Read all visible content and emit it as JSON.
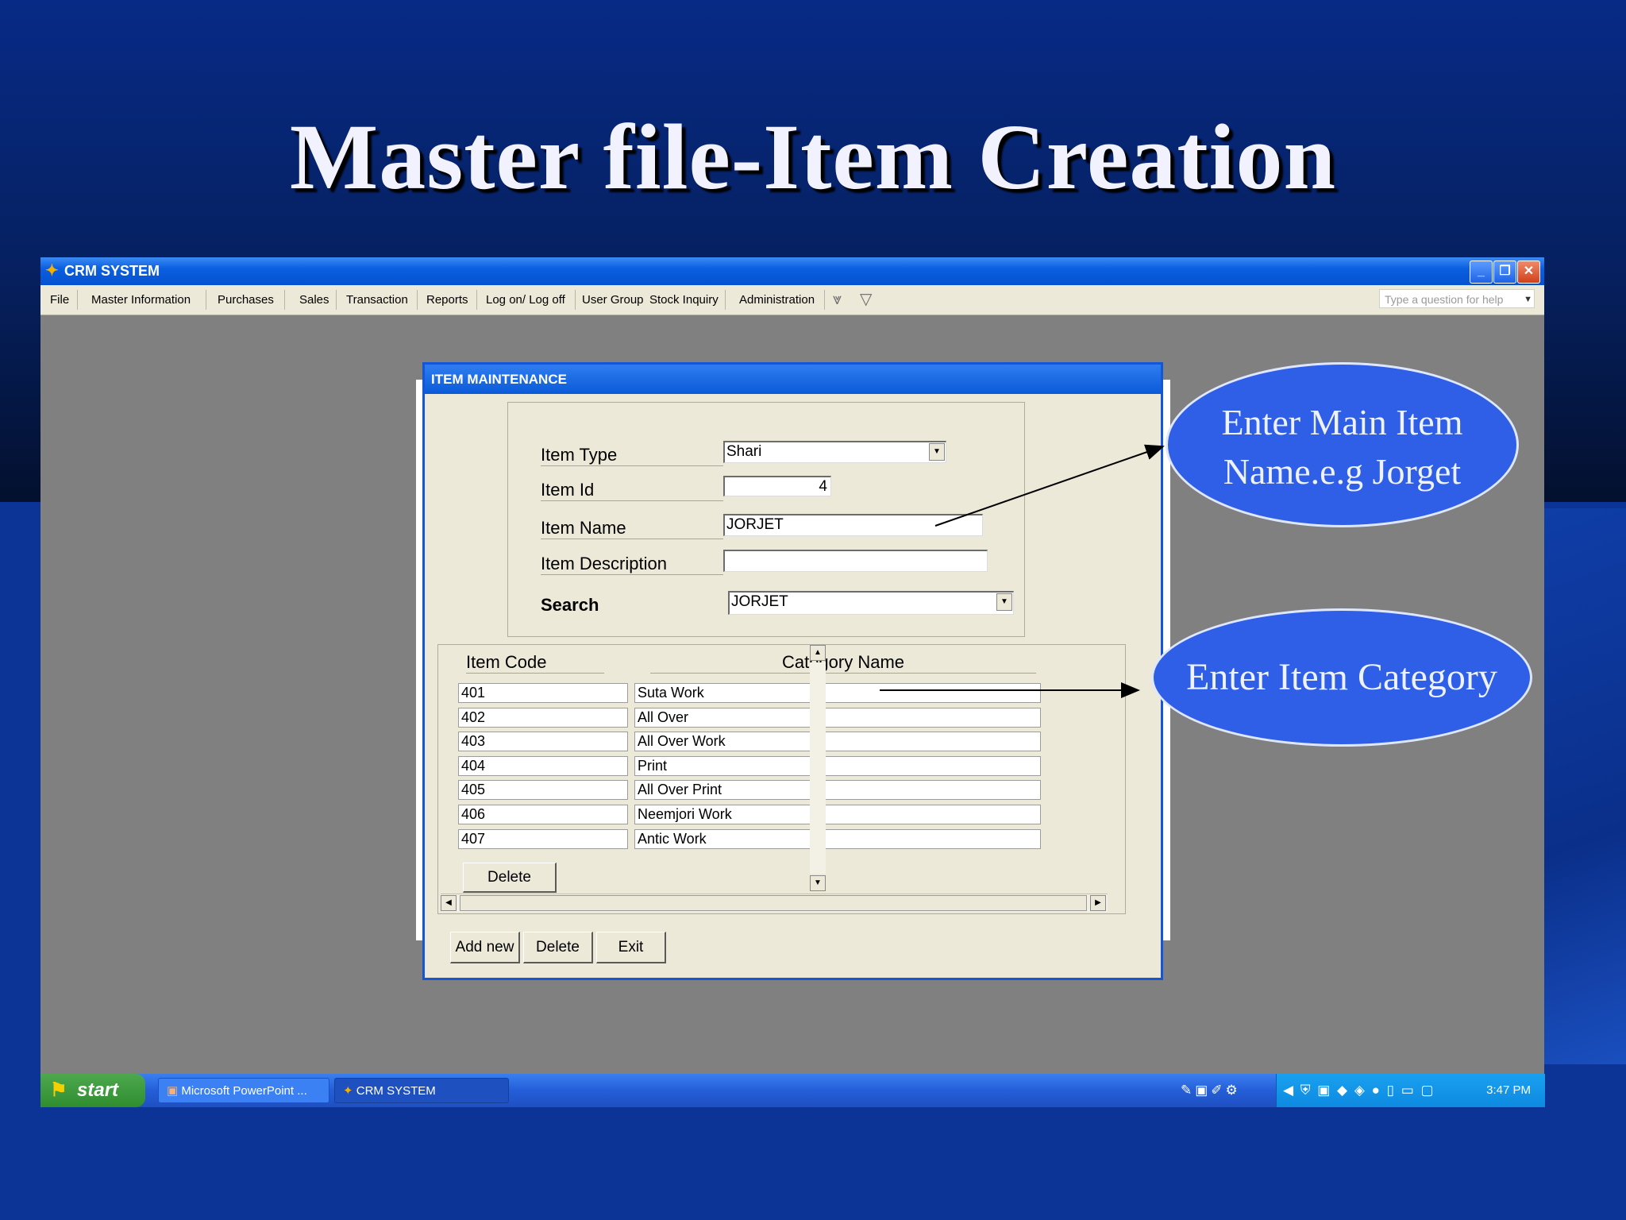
{
  "slide": {
    "title": "Master file-Item Creation"
  },
  "window": {
    "title": "CRM SYSTEM",
    "menu": [
      "File",
      "Master Information",
      "Purchases",
      "Sales",
      "Transaction",
      "Reports",
      "Log on/ Log off",
      "User Group",
      "Stock Inquiry",
      "Administration"
    ],
    "help_placeholder": "Type a question for help"
  },
  "dialog": {
    "title": "ITEM  MAINTENANCE",
    "labels": {
      "item_type": "Item Type",
      "item_id": "Item Id",
      "item_name": "Item Name",
      "item_description": "Item Description",
      "search": "Search"
    },
    "values": {
      "item_type": "Shari",
      "item_id": "4",
      "item_name": "JORJET",
      "item_description": "",
      "search": "JORJET"
    },
    "grid": {
      "headers": {
        "code": "Item Code",
        "name": "Category Name"
      },
      "rows": [
        {
          "code": "401",
          "name": "Suta Work"
        },
        {
          "code": "402",
          "name": "All Over"
        },
        {
          "code": "403",
          "name": "All Over Work"
        },
        {
          "code": "404",
          "name": "Print"
        },
        {
          "code": "405",
          "name": "All Over Print"
        },
        {
          "code": "406",
          "name": "Neemjori Work"
        },
        {
          "code": "407",
          "name": "Antic Work"
        }
      ],
      "delete_label": "Delete"
    },
    "buttons": {
      "add_new": "Add new",
      "delete": "Delete",
      "exit": "Exit"
    }
  },
  "callouts": {
    "main_item": {
      "line1": "Enter Main Item",
      "line2": "Name.e.g Jorget"
    },
    "category": {
      "text": "Enter Item Category"
    }
  },
  "taskbar": {
    "start": "start",
    "tasks": [
      "Microsoft PowerPoint ...",
      "CRM SYSTEM"
    ],
    "clock": "3:47 PM"
  },
  "colors": {
    "slide_blue": "#0c3496",
    "xp_title": "#0a5fe0",
    "dialog_bg": "#ece9d8",
    "callout": "#2f5fe6"
  }
}
